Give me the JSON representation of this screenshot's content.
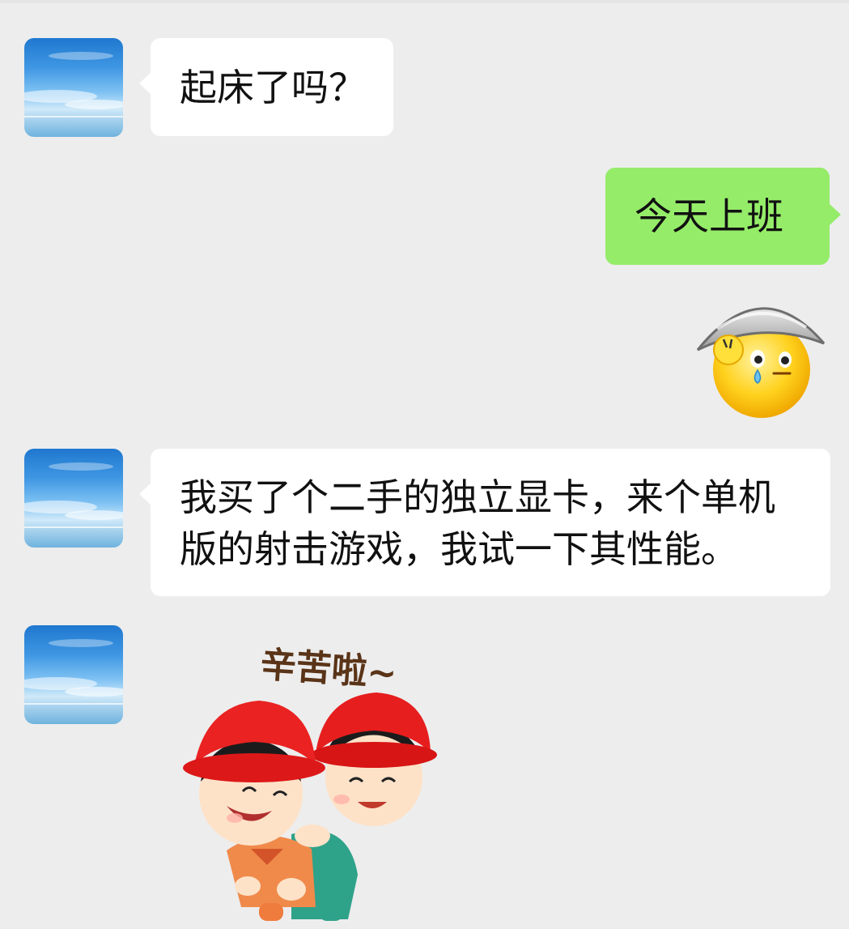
{
  "chat": {
    "messages": [
      {
        "side": "left",
        "type": "text",
        "text": "起床了吗？"
      },
      {
        "side": "right",
        "type": "text",
        "text": "今天上班"
      },
      {
        "side": "right",
        "type": "emoji",
        "icon": "sweating-face-with-pot-emoji"
      },
      {
        "side": "left",
        "type": "text",
        "text": "我买了个二手的独立显卡，来个单机版的射击游戏，我试一下其性能。"
      },
      {
        "side": "left",
        "type": "sticker",
        "icon": "hugging-kids-sticker",
        "caption": "辛苦啦~"
      }
    ]
  },
  "colors": {
    "background": "#ededed",
    "incoming_bubble": "#ffffff",
    "outgoing_bubble": "#95ec69",
    "sticker_text": "#5a3418"
  }
}
